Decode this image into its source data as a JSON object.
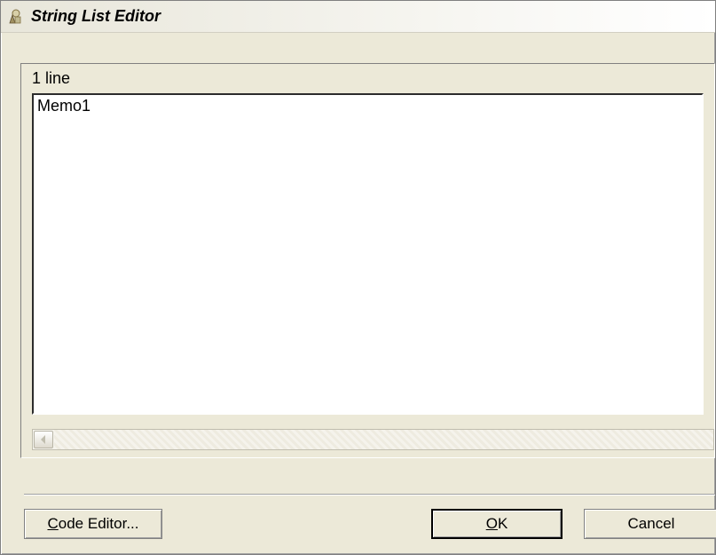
{
  "window": {
    "title": "String List Editor"
  },
  "panel": {
    "line_count_text": "1 line"
  },
  "memo": {
    "value": "Memo1\n"
  },
  "buttons": {
    "code_editor": {
      "prefix": "C",
      "rest": "ode Editor..."
    },
    "ok": {
      "prefix": "O",
      "rest": "K"
    },
    "cancel": "Cancel"
  }
}
